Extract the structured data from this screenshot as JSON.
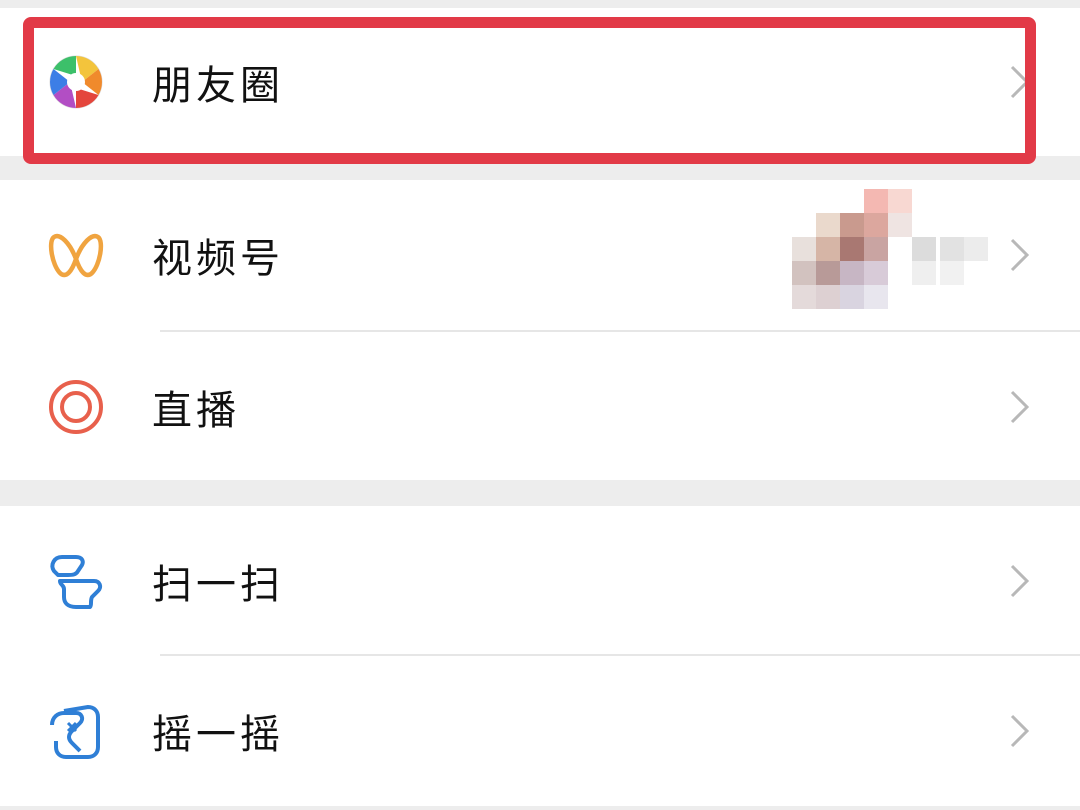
{
  "menu": {
    "moments": {
      "label": "朋友圈",
      "icon": "moments-aperture-icon"
    },
    "channels": {
      "label": "视频号",
      "icon": "channels-butterfly-icon"
    },
    "live": {
      "label": "直播",
      "icon": "live-ring-icon"
    },
    "scan": {
      "label": "扫一扫",
      "icon": "scan-icon"
    },
    "shake": {
      "label": "摇一摇",
      "icon": "shake-icon"
    }
  },
  "colors": {
    "highlight": "#e23a47",
    "channels_icon": "#f0a440",
    "live_icon": "#e8604c",
    "scan_icon": "#2f7fd6",
    "background": "#ededed"
  }
}
